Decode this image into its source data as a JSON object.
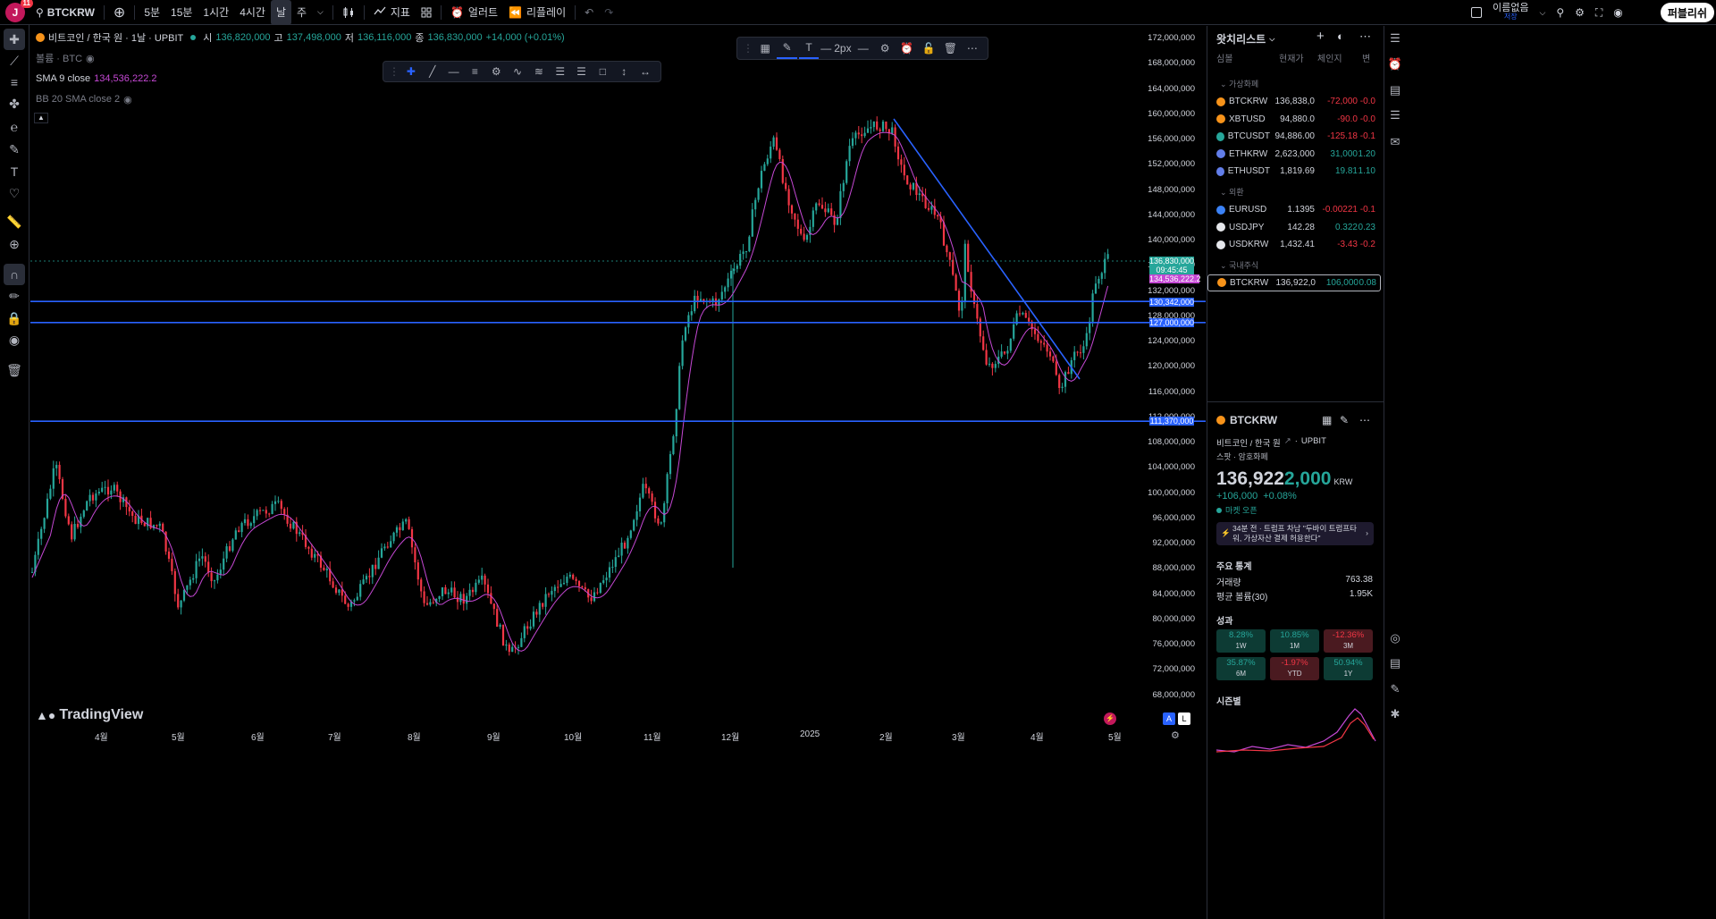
{
  "topbar": {
    "avatar_letter": "J",
    "avatar_badge": "11",
    "symbol": "BTCKRW",
    "intervals": [
      "5분",
      "15분",
      "1시간",
      "4시간",
      "날",
      "주"
    ],
    "indicators_label": "지표",
    "alert_label": "얼러트",
    "replay_label": "리플레이",
    "layout_name": "이름없음",
    "layout_sub": "저장",
    "publish_label": "퍼블리쉬"
  },
  "legend": {
    "title": "비트코인 / 한국 원 · 1날 · UPBIT",
    "open_label": "시",
    "open": "136,820,000",
    "high_label": "고",
    "high": "137,498,000",
    "low_label": "저",
    "low": "136,116,000",
    "close_label": "종",
    "close": "136,830,000",
    "change": "+14,000 (+0.01%)",
    "volume_label": "볼륨 · BTC",
    "sma_label": "SMA 9 close",
    "sma_value": "134,536,222.2",
    "bb_label": "BB 20 SMA close 2"
  },
  "drawing_toolbar": {
    "width_label": "2px"
  },
  "price_axis": [
    "172,000,000",
    "168,000,000",
    "164,000,000",
    "160,000,000",
    "156,000,000",
    "152,000,000",
    "148,000,000",
    "144,000,000",
    "140,000,000",
    "136,000,000",
    "132,000,000",
    "128,000,000",
    "124,000,000",
    "120,000,000",
    "116,000,000",
    "112,000,000",
    "108,000,000",
    "104,000,000",
    "100,000,000",
    "96,000,000",
    "92,000,000",
    "88,000,000",
    "84,000,000",
    "80,000,000",
    "76,000,000",
    "72,000,000",
    "68,000,000"
  ],
  "price_tags": {
    "last": "136,830,000",
    "countdown": "09:45:45",
    "sma": "134,536,222.2",
    "line1": "130,342,000",
    "line2": "127,000,000",
    "line3": "111,370,000"
  },
  "time_axis": [
    "4월",
    "5월",
    "6월",
    "7월",
    "8월",
    "9월",
    "10월",
    "11월",
    "12월",
    "2025",
    "2월",
    "3월",
    "4월",
    "5월"
  ],
  "branding": {
    "logo_text": "TradingView"
  },
  "scale_buttons": [
    "A",
    "L"
  ],
  "watchlist": {
    "title": "왓치리스트",
    "columns": [
      "심볼",
      "현재가",
      "체인지",
      "변"
    ],
    "sections": [
      {
        "name": "가상화폐",
        "rows": [
          {
            "symbol": "BTCKRW",
            "last": "136,838,0",
            "chg": "-72,000",
            "pct": "-0.0",
            "chg_color": "#f23645",
            "coin": "#f7931a"
          },
          {
            "symbol": "XBTUSD",
            "last": "94,880.0",
            "chg": "-90.0",
            "pct": "-0.0",
            "chg_color": "#f23645",
            "coin": "#f7931a"
          },
          {
            "symbol": "BTCUSDT",
            "last": "94,886.00",
            "chg": "-125.18",
            "pct": "-0.1",
            "chg_color": "#f23645",
            "coin": "#26a69a"
          },
          {
            "symbol": "ETHKRW",
            "last": "2,623,000",
            "chg": "31,000",
            "pct": "1.20",
            "chg_color": "#26a69a",
            "coin": "#627eea"
          },
          {
            "symbol": "ETHUSDT",
            "last": "1,819.69",
            "chg": "19.81",
            "pct": "1.10",
            "chg_color": "#26a69a",
            "coin": "#627eea"
          }
        ]
      },
      {
        "name": "외환",
        "rows": [
          {
            "symbol": "EURUSD",
            "last": "1.1395",
            "chg": "-0.00221",
            "pct": "-0.1",
            "chg_color": "#f23645",
            "coin": "#3b82f6"
          },
          {
            "symbol": "USDJPY",
            "last": "142.28",
            "chg": "0.322",
            "pct": "0.23",
            "chg_color": "#26a69a",
            "coin": "#e5e7eb"
          },
          {
            "symbol": "USDKRW",
            "last": "1,432.41",
            "chg": "-3.43",
            "pct": "-0.2",
            "chg_color": "#f23645",
            "coin": "#e5e7eb"
          }
        ]
      },
      {
        "name": "국내주식",
        "rows": [
          {
            "symbol": "BTCKRW",
            "last": "136,922,0",
            "chg": "106,000",
            "pct": "0.08",
            "chg_color": "#26a69a",
            "coin": "#f7931a"
          }
        ]
      }
    ]
  },
  "details": {
    "symbol": "BTCKRW",
    "full_name": "비트코인 / 한국 원",
    "exchange": "UPBIT",
    "type": "스팟 · 암호화폐",
    "price_main": "136,922",
    "price_tail": "2,000",
    "currency": "KRW",
    "change": "+106,000",
    "change_pct": "+0.08%",
    "market_status": "마켓 오픈",
    "news": "34분 전 · 트럼프 차남 \"두바이 트럼프타워, 가상자산 결제 허용한다\"",
    "stats_title": "주요 통계",
    "volume_label": "거래량",
    "volume": "763.38",
    "avg_volume_label": "평균 볼륨(30)",
    "avg_volume": "1.95K",
    "perf_title": "성과",
    "performance": [
      {
        "value": "8.28%",
        "period": "1W",
        "positive": true
      },
      {
        "value": "10.85%",
        "period": "1M",
        "positive": true
      },
      {
        "value": "-12.36%",
        "period": "3M",
        "positive": false
      },
      {
        "value": "35.87%",
        "period": "6M",
        "positive": true
      },
      {
        "value": "-1.97%",
        "period": "YTD",
        "positive": false
      },
      {
        "value": "50.94%",
        "period": "1Y",
        "positive": true
      }
    ],
    "seasonal_title": "시즌별"
  },
  "colors": {
    "up": "#26a69a",
    "down": "#f23645",
    "sma": "#c548d4",
    "hline": "#2962ff",
    "trend": "#2962ff"
  }
}
